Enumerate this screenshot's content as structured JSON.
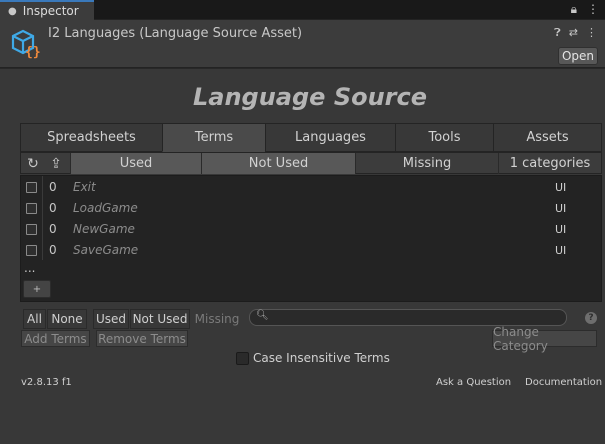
{
  "window": {
    "tab_label": "Inspector",
    "tab_icon": "info-icon"
  },
  "header": {
    "title": "I2 Languages (Language Source Asset)",
    "open_label": "Open"
  },
  "main": {
    "title": "Language Source",
    "tabs": [
      {
        "label": "Spreadsheets",
        "active": false
      },
      {
        "label": "Terms",
        "active": true
      },
      {
        "label": "Languages",
        "active": false
      },
      {
        "label": "Tools",
        "active": false
      },
      {
        "label": "Assets",
        "active": false
      }
    ],
    "filters": {
      "used": "Used",
      "not_used": "Not Used",
      "missing": "Missing",
      "categories": "1 categories"
    },
    "terms": [
      {
        "count": "0",
        "name": "Exit",
        "category": "UI"
      },
      {
        "count": "0",
        "name": "LoadGame",
        "category": "UI"
      },
      {
        "count": "0",
        "name": "NewGame",
        "category": "UI"
      },
      {
        "count": "0",
        "name": "SaveGame",
        "category": "UI"
      }
    ],
    "ellipsis": "...",
    "add_label": "+"
  },
  "selection": {
    "all": "All",
    "none": "None",
    "used": "Used",
    "not_used": "Not Used",
    "missing": "Missing",
    "search_value": ""
  },
  "actions": {
    "add_terms": "Add Terms",
    "remove_terms": "Remove Terms",
    "change_category": "Change Category"
  },
  "options": {
    "case_insensitive": "Case Insensitive Terms"
  },
  "footer": {
    "version": "v2.8.13 f1",
    "ask": "Ask a Question",
    "docs": "Documentation"
  },
  "colors": {
    "accent": "#3a79bb",
    "icon_blue": "#3fa9e6",
    "icon_orange": "#f08a3c"
  }
}
